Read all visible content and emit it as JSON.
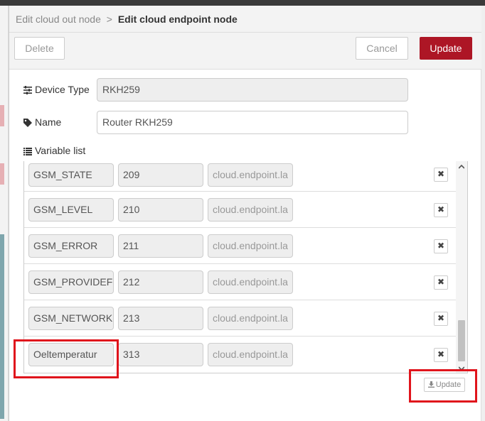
{
  "breadcrumb": {
    "parent": "Edit cloud out node",
    "separator": ">",
    "current": "Edit cloud endpoint node"
  },
  "toolbar": {
    "delete_label": "Delete",
    "cancel_label": "Cancel",
    "update_label": "Update"
  },
  "form": {
    "device_type": {
      "label": "Device Type",
      "value": "RKH259",
      "icon": "sliders-icon"
    },
    "name": {
      "label": "Name",
      "value": "Router RKH259",
      "icon": "tag-icon"
    },
    "variable_list": {
      "label": "Variable list",
      "icon": "list-icon"
    }
  },
  "variables": [
    {
      "name": "GSM_STATE",
      "id": "209",
      "path": "cloud.endpoint.la"
    },
    {
      "name": "GSM_LEVEL",
      "id": "210",
      "path": "cloud.endpoint.la"
    },
    {
      "name": "GSM_ERROR",
      "id": "211",
      "path": "cloud.endpoint.la"
    },
    {
      "name": "GSM_PROVIDEF",
      "id": "212",
      "path": "cloud.endpoint.la"
    },
    {
      "name": "GSM_NETWORK",
      "id": "213",
      "path": "cloud.endpoint.la"
    },
    {
      "name": "Oeltemperatur",
      "id": "313",
      "path": "cloud.endpoint.la"
    }
  ],
  "list_actions": {
    "update_label": "Update",
    "delete_glyph": "✖"
  },
  "colors": {
    "primary_button": "#ad1625",
    "highlight_box": "#e0141c"
  }
}
